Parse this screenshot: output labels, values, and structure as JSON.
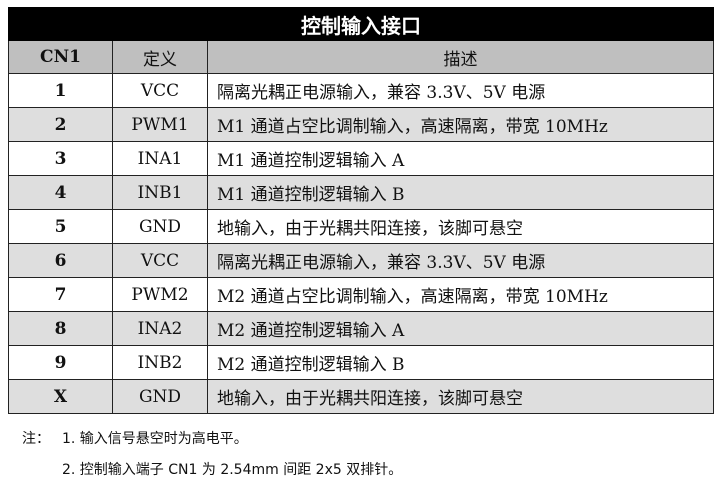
{
  "title": "控制输入接口",
  "headers": {
    "cn": "CN1",
    "definition": "定义",
    "description": "描述"
  },
  "rows": [
    {
      "num": "1",
      "def": "VCC",
      "desc": "隔离光耦正电源输入，兼容 3.3V、5V 电源"
    },
    {
      "num": "2",
      "def": "PWM1",
      "desc": "M1 通道占空比调制输入，高速隔离，带宽 10MHz"
    },
    {
      "num": "3",
      "def": "INA1",
      "desc": "M1 通道控制逻辑输入 A"
    },
    {
      "num": "4",
      "def": "INB1",
      "desc": "M1 通道控制逻辑输入 B"
    },
    {
      "num": "5",
      "def": "GND",
      "desc": "地输入，由于光耦共阳连接，该脚可悬空"
    },
    {
      "num": "6",
      "def": "VCC",
      "desc": "隔离光耦正电源输入，兼容 3.3V、5V 电源"
    },
    {
      "num": "7",
      "def": "PWM2",
      "desc": "M2 通道占空比调制输入，高速隔离，带宽 10MHz"
    },
    {
      "num": "8",
      "def": "INA2",
      "desc": "M2 通道控制逻辑输入 A"
    },
    {
      "num": "9",
      "def": "INB2",
      "desc": "M2 通道控制逻辑输入 B"
    },
    {
      "num": "X",
      "def": "GND",
      "desc": "地输入，由于光耦共阳连接，该脚可悬空"
    }
  ],
  "notes": {
    "prefix": "注：",
    "items": [
      "1. 输入信号悬空时为高电平。",
      "2. 控制输入端子 CN1 为 2.54mm 间距 2x5 双排针。"
    ]
  },
  "colors": {
    "title_bg": "#000000",
    "header_bg": "#bfbfbf",
    "alt_row_bg": "#dedede"
  }
}
